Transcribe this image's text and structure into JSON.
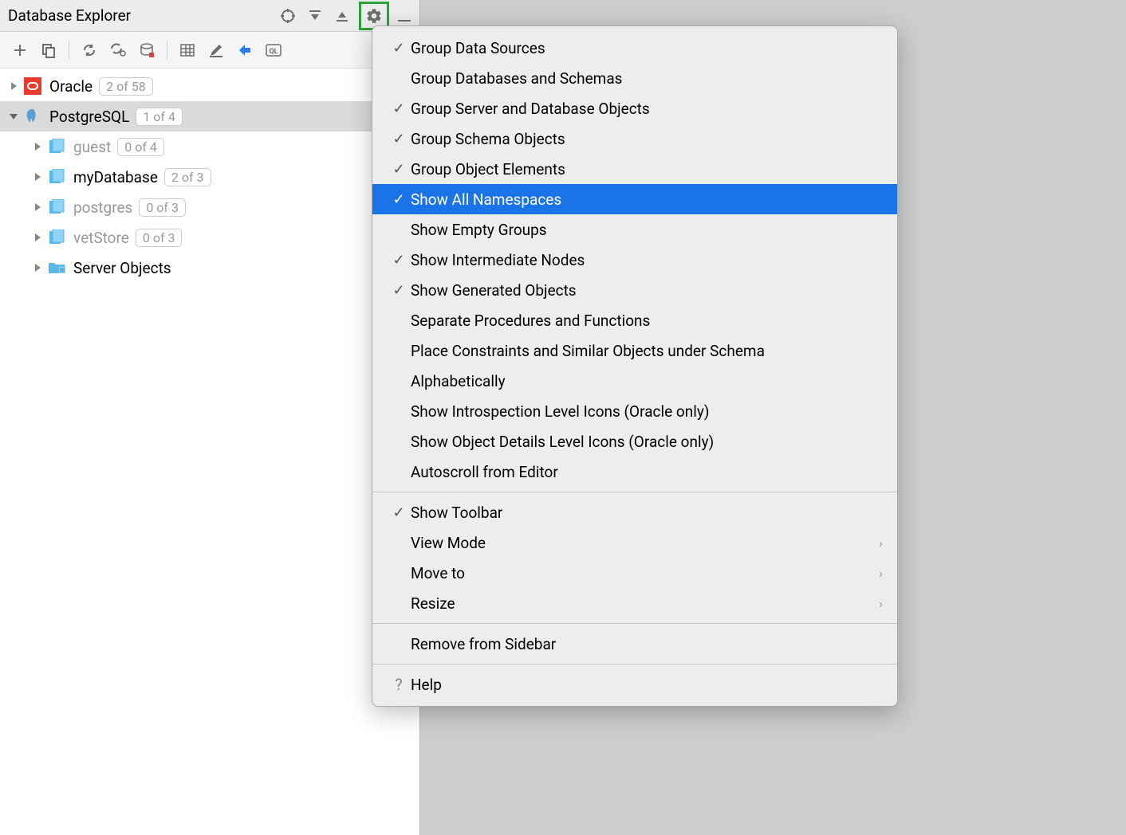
{
  "panel": {
    "title": "Database Explorer"
  },
  "tree": {
    "items": [
      {
        "name": "Oracle",
        "badge": "2 of 58",
        "expanded": false,
        "icon": "oracle",
        "selected": false,
        "muted": false,
        "level": 0
      },
      {
        "name": "PostgreSQL",
        "badge": "1 of 4",
        "expanded": true,
        "icon": "postgres",
        "selected": true,
        "muted": false,
        "level": 0
      },
      {
        "name": "guest",
        "badge": "0 of 4",
        "expanded": false,
        "icon": "db",
        "selected": false,
        "muted": true,
        "level": 1
      },
      {
        "name": "myDatabase",
        "badge": "2 of 3",
        "expanded": false,
        "icon": "db",
        "selected": false,
        "muted": false,
        "level": 1
      },
      {
        "name": "postgres",
        "badge": "0 of 3",
        "expanded": false,
        "icon": "db",
        "selected": false,
        "muted": true,
        "level": 1
      },
      {
        "name": "vetStore",
        "badge": "0 of 3",
        "expanded": false,
        "icon": "db",
        "selected": false,
        "muted": true,
        "level": 1
      },
      {
        "name": "Server Objects",
        "badge": "",
        "expanded": false,
        "icon": "folder",
        "selected": false,
        "muted": false,
        "level": 1
      }
    ]
  },
  "menu": {
    "groups": [
      [
        {
          "label": "Group Data Sources",
          "checked": true,
          "submenu": false
        },
        {
          "label": "Group Databases and Schemas",
          "checked": false,
          "submenu": false
        },
        {
          "label": "Group Server and Database Objects",
          "checked": true,
          "submenu": false
        },
        {
          "label": "Group Schema Objects",
          "checked": true,
          "submenu": false
        },
        {
          "label": "Group Object Elements",
          "checked": true,
          "submenu": false
        },
        {
          "label": "Show All Namespaces",
          "checked": true,
          "submenu": false,
          "highlighted": true
        },
        {
          "label": "Show Empty Groups",
          "checked": false,
          "submenu": false
        },
        {
          "label": "Show Intermediate Nodes",
          "checked": true,
          "submenu": false
        },
        {
          "label": "Show Generated Objects",
          "checked": true,
          "submenu": false
        },
        {
          "label": "Separate Procedures and Functions",
          "checked": false,
          "submenu": false
        },
        {
          "label": "Place Constraints and Similar Objects under Schema",
          "checked": false,
          "submenu": false
        },
        {
          "label": "Alphabetically",
          "checked": false,
          "submenu": false
        },
        {
          "label": "Show Introspection Level Icons (Oracle only)",
          "checked": false,
          "submenu": false
        },
        {
          "label": "Show Object Details Level Icons (Oracle only)",
          "checked": false,
          "submenu": false
        },
        {
          "label": "Autoscroll from Editor",
          "checked": false,
          "submenu": false
        }
      ],
      [
        {
          "label": "Show Toolbar",
          "checked": true,
          "submenu": false
        },
        {
          "label": "View Mode",
          "checked": false,
          "submenu": true
        },
        {
          "label": "Move to",
          "checked": false,
          "submenu": true
        },
        {
          "label": "Resize",
          "checked": false,
          "submenu": true
        }
      ],
      [
        {
          "label": "Remove from Sidebar",
          "checked": false,
          "submenu": false
        }
      ],
      [
        {
          "label": "Help",
          "checked": false,
          "submenu": false,
          "help": true
        }
      ]
    ]
  }
}
